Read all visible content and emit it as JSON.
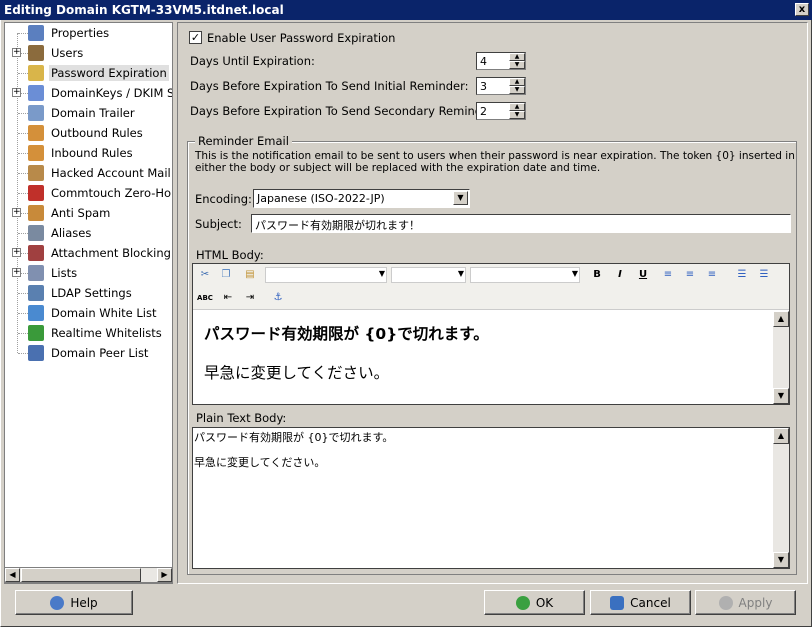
{
  "window": {
    "title": "Editing Domain KGTM-33VM5.itdnet.local",
    "close_glyph": "x"
  },
  "tree": {
    "items": [
      {
        "label": "Properties",
        "icon": "properties-icon",
        "color": "#5b7fbf",
        "expandable": false
      },
      {
        "label": "Users",
        "icon": "users-icon",
        "color": "#8b6b3d",
        "expandable": true
      },
      {
        "label": "Password Expiration",
        "icon": "key-user-icon",
        "color": "#d9b54a",
        "expandable": false,
        "selected": true
      },
      {
        "label": "DomainKeys / DKIM Sig",
        "icon": "domainkeys-icon",
        "color": "#6b8ed6",
        "expandable": true
      },
      {
        "label": "Domain Trailer",
        "icon": "pen-icon",
        "color": "#7a9ac9",
        "expandable": false
      },
      {
        "label": "Outbound Rules",
        "icon": "outbound-rules-icon",
        "color": "#d4903a",
        "expandable": false
      },
      {
        "label": "Inbound Rules",
        "icon": "inbound-rules-icon",
        "color": "#d4903a",
        "expandable": false
      },
      {
        "label": "Hacked Account Mail Re",
        "icon": "hacked-account-icon",
        "color": "#b88a4a",
        "expandable": false
      },
      {
        "label": "Commtouch Zero-Hour",
        "icon": "commtouch-icon",
        "color": "#c0302a",
        "expandable": false
      },
      {
        "label": "Anti Spam",
        "icon": "anti-spam-icon",
        "color": "#c88a3a",
        "expandable": true
      },
      {
        "label": "Aliases",
        "icon": "aliases-icon",
        "color": "#7a8aa0",
        "expandable": false
      },
      {
        "label": "Attachment Blocking",
        "icon": "attachment-blocking-icon",
        "color": "#a04040",
        "expandable": true
      },
      {
        "label": "Lists",
        "icon": "lists-icon",
        "color": "#8090b0",
        "expandable": true
      },
      {
        "label": "LDAP Settings",
        "icon": "ldap-icon",
        "color": "#5a80b0",
        "expandable": false
      },
      {
        "label": "Domain White List",
        "icon": "globe-icon",
        "color": "#4a8ad0",
        "expandable": false
      },
      {
        "label": "Realtime Whitelists",
        "icon": "checkmark-icon",
        "color": "#3a9a3a",
        "expandable": false
      },
      {
        "label": "Domain Peer List",
        "icon": "peers-icon",
        "color": "#4a70b0",
        "expandable": false
      }
    ]
  },
  "form": {
    "enable_label": "Enable User Password Expiration",
    "enable_checked": "✓",
    "days_until_label": "Days Until Expiration:",
    "days_until_value": "4",
    "initial_label": "Days Before Expiration To Send Initial Reminder:",
    "initial_value": "3",
    "secondary_label": "Days Before Expiration To Send Secondary Reminder:",
    "secondary_value": "2"
  },
  "reminder": {
    "group_title": "Reminder Email",
    "description_line1": "This is the notification email to be sent to users when their password is near expiration. The token {0} inserted in",
    "description_line2": "either the body or subject will be replaced with the expiration date and time.",
    "encoding_label": "Encoding:",
    "encoding_value": "Japanese (ISO-2022-JP)",
    "subject_label": "Subject:",
    "subject_value": "パスワード有効期限が切れます！",
    "html_body_label": "HTML Body:",
    "html_line1": "パスワード有効期限が {0}で切れます。",
    "html_line2": "早急に変更してください。",
    "plain_body_label": "Plain Text Body:",
    "plain_line1": "パスワード有効期限が {0}で切れます。",
    "plain_line2": "早急に変更してください。"
  },
  "toolbar": {
    "bold": "B",
    "italic": "I",
    "underline": "U",
    "spell": "ABC"
  },
  "buttons": {
    "help": "Help",
    "ok": "OK",
    "cancel": "Cancel",
    "apply": "Apply"
  }
}
